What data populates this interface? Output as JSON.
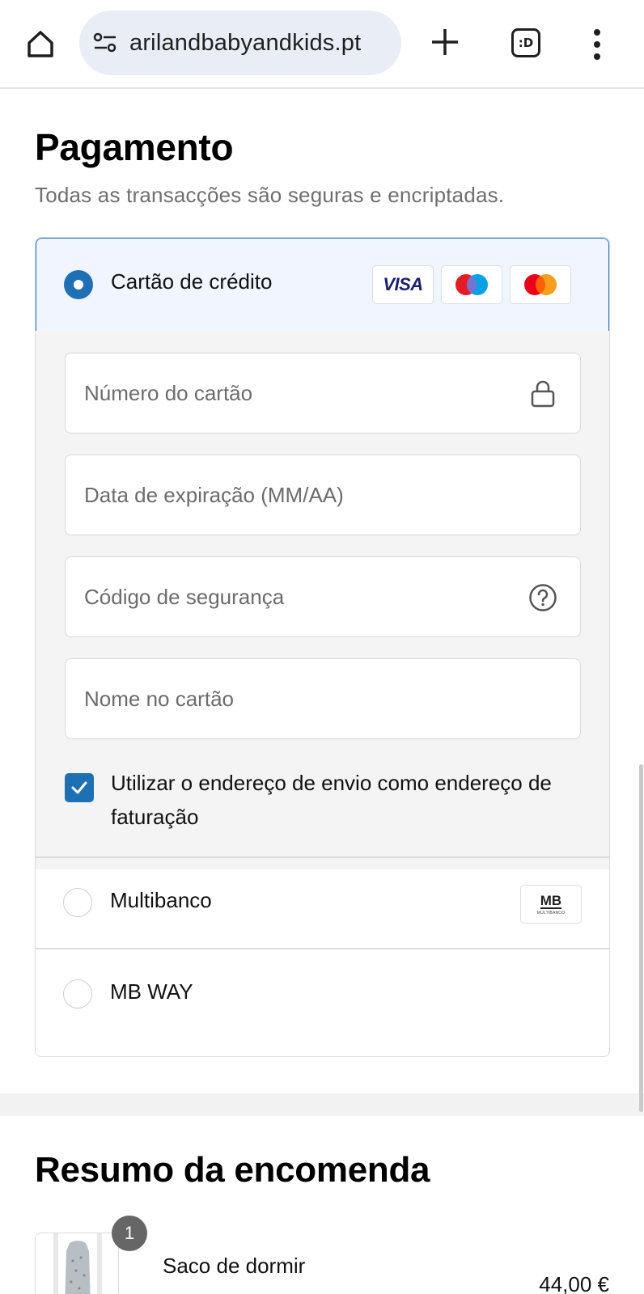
{
  "browser": {
    "url": "arilandbabyandkids.pt",
    "tabs_label": ":D",
    "icons": [
      "home-icon",
      "site-settings-icon",
      "new-tab-icon",
      "tab-switcher-icon",
      "more-menu-icon"
    ]
  },
  "payment": {
    "title": "Pagamento",
    "subtitle": "Todas as transacções são seguras e encriptadas.",
    "credit_card": {
      "label": "Cartão de crédito",
      "selected": true,
      "brands": [
        "VISA",
        "maestro",
        "mastercard"
      ],
      "visa_label": "VISA",
      "fields": {
        "card_number_placeholder": "Número do cartão",
        "expiry_placeholder": "Data de expiração (MM/AA)",
        "security_code_placeholder": "Código de segurança",
        "name_placeholder": "Nome no cartão"
      },
      "billing_checkbox": {
        "label": "Utilizar o endereço de envio como endereço de faturação",
        "checked": true
      }
    },
    "multibanco": {
      "label": "Multibanco",
      "logo_text": "MB",
      "logo_subtext": "MULTIBANCO"
    },
    "mbway": {
      "label": "MB WAY"
    }
  },
  "order_summary": {
    "title": "Resumo da encomenda",
    "items": [
      {
        "quantity": "1",
        "name": "Saco de dormir",
        "price": "44,00 €"
      }
    ]
  },
  "colors": {
    "accent": "#1f6fb5",
    "selected_bg": "#f0f5ff",
    "form_bg": "#f4f4f4",
    "visa_blue": "#1a1f71",
    "mastercard_red": "#eb001b",
    "mastercard_orange": "#f79e1b",
    "maestro_blue": "#00a2e5"
  }
}
